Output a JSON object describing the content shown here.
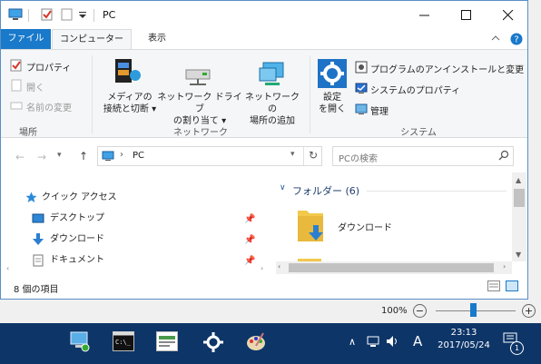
{
  "window": {
    "title": "PC"
  },
  "tabs": [
    {
      "label": "ファイル"
    },
    {
      "label": "コンピューター"
    },
    {
      "label": "表示"
    }
  ],
  "ribbon": {
    "location_group": {
      "label": "場所",
      "properties": "プロパティ",
      "open": "開く",
      "rename": "名前の変更"
    },
    "network_group": {
      "label": "ネットワーク",
      "media_line1": "メディアの",
      "media_line2": "接続と切断",
      "map_line1": "ネットワーク ドライブ",
      "map_line2": "の割り当て",
      "addloc_line1": "ネットワークの",
      "addloc_line2": "場所の追加"
    },
    "system_group": {
      "label": "システム",
      "settings_line1": "設定",
      "settings_line2": "を開く",
      "uninstall": "プログラムのアンインストールと変更",
      "sysprops": "システムのプロパティ",
      "manage": "管理"
    }
  },
  "address": {
    "path": "PC",
    "search_placeholder": "PCの検索"
  },
  "nav": {
    "items": [
      {
        "label": "クイック アクセス"
      },
      {
        "label": "デスクトップ"
      },
      {
        "label": "ダウンロード"
      },
      {
        "label": "ドキュメント"
      }
    ]
  },
  "content": {
    "section_title": "フォルダー (6)",
    "items": [
      {
        "label": "ダウンロード"
      }
    ]
  },
  "status": {
    "item_count": "8 個の項目"
  },
  "zoom": {
    "level": "100%",
    "minus": "−",
    "plus": "+"
  },
  "taskbar": {
    "ime": "A",
    "time": "23:13",
    "date": "2017/05/24",
    "notification_count": "1"
  },
  "colors": {
    "accent": "#1979ca",
    "taskbar": "#0d3568",
    "folder": "#f2c94c"
  }
}
